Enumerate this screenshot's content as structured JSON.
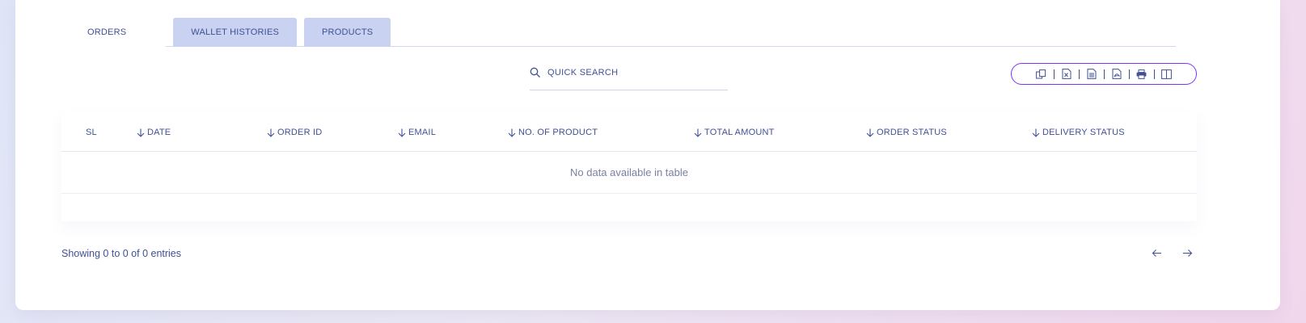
{
  "tabs": [
    {
      "label": "ORDERS"
    },
    {
      "label": "WALLET HISTORIES"
    },
    {
      "label": "PRODUCTS"
    }
  ],
  "search": {
    "placeholder": "QUICK SEARCH",
    "icon": "search-icon"
  },
  "toolbar": {
    "icons": [
      "copy-icon",
      "excel-icon",
      "csv-icon",
      "pdf-icon",
      "print-icon",
      "columns-icon"
    ],
    "accent": "#7c32ff"
  },
  "table": {
    "columns": [
      {
        "label": "SL",
        "sortable": false
      },
      {
        "label": "DATE",
        "sortable": true
      },
      {
        "label": "ORDER ID",
        "sortable": true
      },
      {
        "label": "EMAIL",
        "sortable": true
      },
      {
        "label": "NO. OF PRODUCT",
        "sortable": true
      },
      {
        "label": "TOTAL AMOUNT",
        "sortable": true
      },
      {
        "label": "ORDER STATUS",
        "sortable": true
      },
      {
        "label": "DELIVERY STATUS",
        "sortable": true
      }
    ],
    "empty_text": "No data available in table"
  },
  "footer": {
    "info": "Showing 0 to 0 of 0 entries",
    "prev_icon": "arrow-left-icon",
    "next_icon": "arrow-right-icon"
  },
  "colors": {
    "text": "#415094",
    "tab_inactive": "#c9d2f0",
    "accent": "#7c32ff"
  }
}
